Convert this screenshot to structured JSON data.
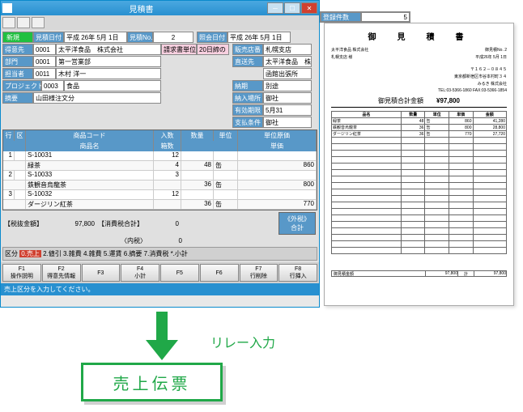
{
  "window": {
    "title": "見積書",
    "close": "✕",
    "min": "─",
    "max": "☐"
  },
  "regcount": {
    "label": "登録件数",
    "value": "5"
  },
  "header": {
    "badge": "新規",
    "date_lbl": "見積日付",
    "date": "平成 26年 5月 1日",
    "no_lbl": "見積No.",
    "no": "2",
    "inq_date_lbl": "照会日付",
    "inq_date": "平成 26年 5月 1日",
    "cust_lbl": "得意先",
    "cust_code": "0001",
    "cust_name": "太平洋食品　株式会社",
    "req_unit_lbl": "請求書単位",
    "req_unit": "20日締の",
    "dept_lbl": "部門",
    "dept_code": "0001",
    "dept_name": "第一営業部",
    "person_lbl": "担当者",
    "person_code": "0011",
    "person_name": "木村 洋一",
    "proj_lbl": "プロジェクト",
    "proj_code": "0003",
    "proj_name": "食品",
    "summary_lbl": "摘要",
    "summary": "山田様注文分",
    "sales_lbl": "販売店番",
    "sales_name": "札幌支店",
    "dest_lbl": "直送先",
    "dest_name": "太平洋食品　株式会",
    "dest2": "函館出張所",
    "info1": "納期",
    "info2": "納入場所",
    "info3": "有効期限",
    "info4": "支払条件",
    "val1": "別途",
    "val2": "御社",
    "val3": "5月31",
    "val4": "御社"
  },
  "grid": {
    "cols": {
      "line": "行",
      "kbn": "区",
      "code": "商品コード",
      "name": "商品名",
      "boxes": "入数",
      "cases": "箱数",
      "qty": "数量",
      "unit": "単位",
      "uprice": "単位原価",
      "price": "単価"
    },
    "rows": [
      {
        "n": "1",
        "c": "S-10031",
        "nm": "緑茶",
        "in": "12",
        "bx": "4",
        "qty": "48",
        "u": "缶",
        "up": "",
        "pr": "860"
      },
      {
        "n": "2",
        "c": "S-10033",
        "nm": "鉄観音烏龍茶",
        "in": "3",
        "bx": "",
        "qty": "36",
        "u": "缶",
        "up": "",
        "pr": "800"
      },
      {
        "n": "3",
        "c": "S-10032",
        "nm": "ダージリン紅茶",
        "in": "12",
        "bx": "",
        "qty": "36",
        "u": "缶",
        "up": "",
        "pr": "770"
      }
    ]
  },
  "totals": {
    "l1": "【税抜金額】",
    "v1": "97,800",
    "l2": "【消費税合計】",
    "v2": "0",
    "l3": "〈内税〉",
    "v3": "0",
    "btn": "《外税》\n合計"
  },
  "kbn": {
    "lbl": "区分",
    "opts": [
      "0.売上",
      "2.値引",
      "3.雑費",
      "4.雑費",
      "5.運賃",
      "6.摘要",
      "7.消費税",
      "*.小計"
    ]
  },
  "fkeys": [
    {
      "k": "F1",
      "l": "操作説明"
    },
    {
      "k": "F2",
      "l": "得意先情報"
    },
    {
      "k": "F3",
      "l": ""
    },
    {
      "k": "F4",
      "l": "小計"
    },
    {
      "k": "F5",
      "l": ""
    },
    {
      "k": "F6",
      "l": ""
    },
    {
      "k": "F7",
      "l": "行削除"
    },
    {
      "k": "F8",
      "l": "行挿入"
    }
  ],
  "status": "売上区分を入力してください。",
  "preview": {
    "title": "御　見　積　書",
    "to": "太平洋食品 株式会社",
    "to2": "札幌支店 様",
    "no": "御見積No. 2",
    "date": "平成26年 5月 1日",
    "addr1": "〒１６２－０８４５",
    "addr2": "東京都新宿区市谷本村町３４",
    "co": "みるき 株式会社",
    "tel": "TEL:03-5366-1860  FAX:03-5366-1854",
    "total_lbl": "御見積合計金額",
    "total": "¥97,800",
    "items": [
      {
        "nm": "緑茶",
        "q": "48",
        "u": "缶",
        "p": "860",
        "a": "41,280"
      },
      {
        "nm": "鉄観音烏龍茶",
        "q": "36",
        "u": "缶",
        "p": "800",
        "a": "28,800"
      },
      {
        "nm": "ダージリン紅茶",
        "q": "36",
        "u": "缶",
        "p": "770",
        "a": "27,720"
      }
    ],
    "subt_lbl": "御見積金額",
    "subt": "97,800",
    "tax_lbl": "計",
    "tax": "97,800"
  },
  "relay": "リレー入力",
  "card": "売上伝票"
}
